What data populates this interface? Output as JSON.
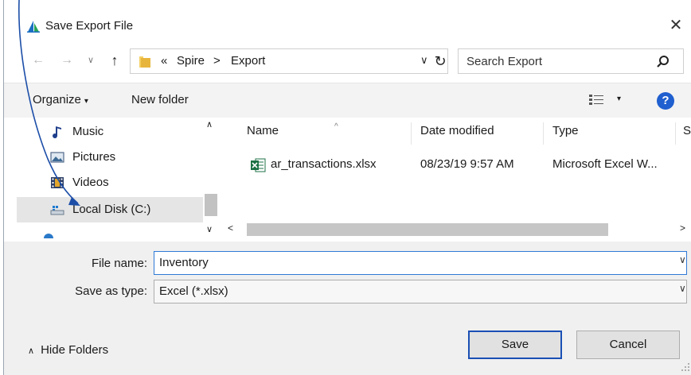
{
  "window": {
    "title": "Save Export File",
    "close_glyph": "✕"
  },
  "address": {
    "back_glyph": "←",
    "forward_glyph": "→",
    "recent_glyph": "∨",
    "up_glyph": "↑",
    "breadcrumb": {
      "overflow": "«",
      "parent": "Spire",
      "separator": ">",
      "current": "Export"
    },
    "dropdown_glyph": "∨",
    "refresh_glyph": "↻"
  },
  "search": {
    "placeholder": "Search Export",
    "icon": "search-icon"
  },
  "toolbar": {
    "organize_label": "Organize",
    "organize_caret": "▾",
    "new_folder_label": "New folder",
    "views_caret": "▾",
    "help_label": "?"
  },
  "nav": {
    "items": [
      {
        "label": "Music",
        "icon": "music-icon"
      },
      {
        "label": "Pictures",
        "icon": "pictures-icon"
      },
      {
        "label": "Videos",
        "icon": "videos-icon"
      },
      {
        "label": "Local Disk (C:)",
        "icon": "drive-icon",
        "selected": true
      }
    ],
    "scroll_up_glyph": "∧",
    "scroll_down_glyph": "∨"
  },
  "files": {
    "columns": [
      "Name",
      "Date modified",
      "Type",
      "S"
    ],
    "sort_glyph": "^",
    "rows": [
      {
        "name": "ar_transactions.xlsx",
        "date": "08/23/19 9:57 AM",
        "type": "Microsoft Excel W...",
        "icon": "excel-file-icon"
      }
    ],
    "scroll_left_glyph": "<",
    "scroll_right_glyph": ">"
  },
  "form": {
    "file_name_label": "File name:",
    "file_name_value": "Inventory",
    "save_as_type_label": "Save as type:",
    "save_as_type_value": "Excel (*.xlsx)",
    "dropdown_glyph": "∨"
  },
  "footer": {
    "hide_folders_glyph": "∧",
    "hide_folders_label": "Hide Folders",
    "save_label": "Save",
    "cancel_label": "Cancel"
  },
  "colors": {
    "accent": "#2f7ad6",
    "annotation_arrow": "#1c4ea8",
    "selection": "#e5e5e5",
    "excel_green": "#1d7044",
    "folder_yellow": "#e8b53c"
  }
}
